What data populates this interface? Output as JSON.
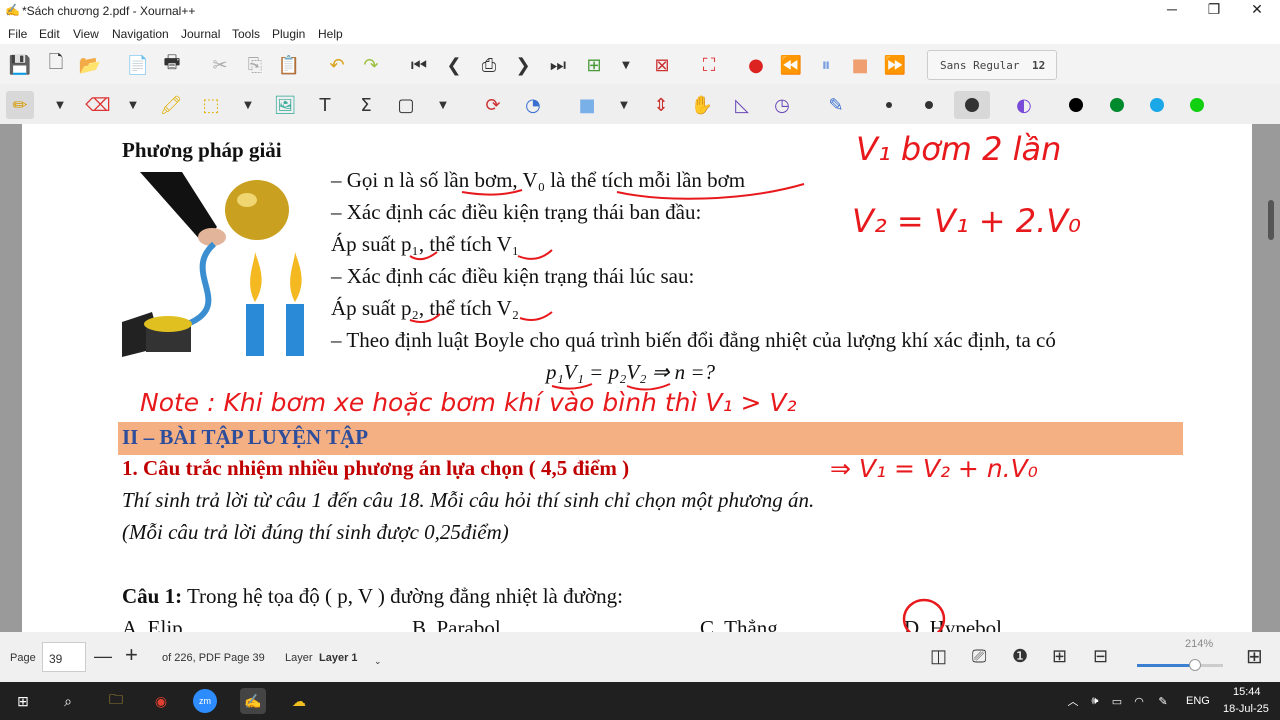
{
  "window": {
    "title": "*Sách chương 2.pdf - Xournal++",
    "minimize": "─",
    "restore": "❐",
    "close": "✕"
  },
  "menu": [
    "File",
    "Edit",
    "View",
    "Navigation",
    "Journal",
    "Tools",
    "Plugin",
    "Help"
  ],
  "toolbar": {
    "font_name": "Sans Regular",
    "font_size": "12"
  },
  "doc": {
    "heading": "Phương pháp giải",
    "lines": [
      "– Gọi n là số lần bơm, V₀ là thể tích mỗi lần bơm",
      "– Xác định các điều kiện trạng thái ban đầu:",
      "Áp suất p₁, thể tích V₁",
      "– Xác định các điều kiện trạng thái lúc sau:",
      "Áp suất p₂, thể tích V₂",
      "– Theo định luật Boyle cho quá trình biến đổi đẳng nhiệt của lượng khí xác định, ta có"
    ],
    "formula": "p₁V₁ = p₂V₂ ⇒ n =?",
    "section": "II – BÀI TẬP LUYỆN TẬP",
    "subsection": "1. Câu trắc nhiệm nhiều phương án lựa chọn ( 4,5 điểm )",
    "instr1": "Thí sinh trả lời từ câu 1 đến câu 18. Mỗi câu hỏi thí sinh chỉ chọn một phương án.",
    "instr2": "(Mỗi câu trả lời đúng thí sinh được 0,25điểm)",
    "q1_label": "Câu 1:",
    "q1_text": " Trong hệ tọa độ ( p, V ) đường đẳng nhiệt là đường:",
    "options": [
      "A. Elip",
      "B. Parabol",
      "C. Thẳng",
      "D. Hypebol"
    ]
  },
  "handwriting": {
    "note1": "V₁ bơm 2 lần",
    "note2": "V₂ = V₁ + 2.V₀",
    "note3": "Note : Khi bơm xe hoặc bơm khí vào bình thì V₁ > V₂",
    "note4": "⇒ V₁ = V₂ + n.V₀",
    "ink_color": "#e8191c"
  },
  "status": {
    "page_label": "Page",
    "page_value": "39",
    "minus": "—",
    "plus": "+",
    "of_pages": "of 226, PDF Page 39",
    "layer_label": "Layer",
    "layer_value": "Layer 1",
    "zoom": "214%"
  },
  "taskbar": {
    "lang": "ENG",
    "time": "15:44",
    "date": "18-Jul-25"
  }
}
